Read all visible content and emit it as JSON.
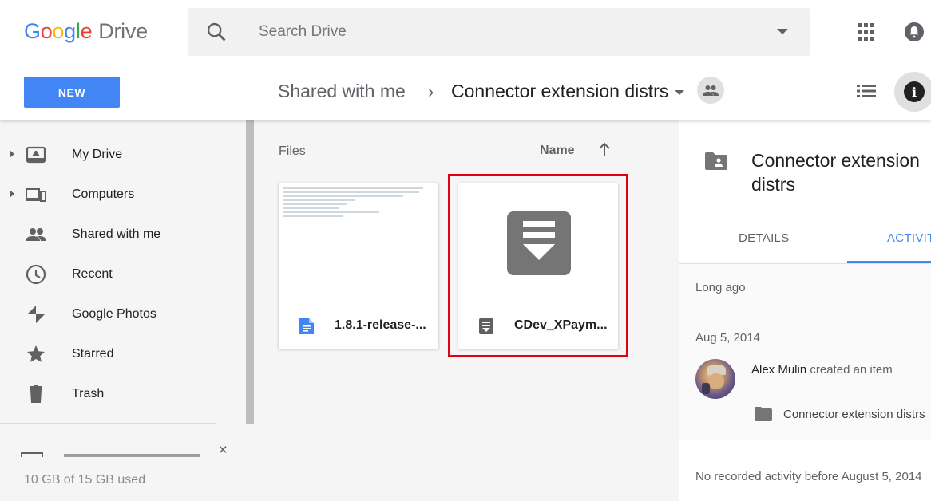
{
  "header": {
    "logo_google": "Google",
    "logo_drive": "Drive",
    "search_placeholder": "Search Drive",
    "new_button": "NEW",
    "breadcrumb_parent": "Shared with me",
    "breadcrumb_separator": "›",
    "breadcrumb_current": "Connector extension distrs"
  },
  "sidebar": {
    "items": [
      {
        "label": "My Drive",
        "icon": "drive-icon",
        "expandable": true
      },
      {
        "label": "Computers",
        "icon": "computers-icon",
        "expandable": true
      },
      {
        "label": "Shared with me",
        "icon": "people-icon",
        "expandable": false
      },
      {
        "label": "Recent",
        "icon": "clock-icon",
        "expandable": false
      },
      {
        "label": "Google Photos",
        "icon": "pinwheel-icon",
        "expandable": false
      },
      {
        "label": "Starred",
        "icon": "star-icon",
        "expandable": false
      },
      {
        "label": "Trash",
        "icon": "trash-icon",
        "expandable": false
      }
    ],
    "storage": "10 GB of 15 GB used"
  },
  "main": {
    "section_label": "Files",
    "sort_label": "Name",
    "files": [
      {
        "name": "1.8.1-release-...",
        "icon": "google-doc-icon"
      },
      {
        "name": "CDev_XPaym...",
        "icon": "download-file-icon"
      }
    ]
  },
  "details": {
    "title_line1": "Connector extension",
    "title_line2": "distrs",
    "tabs": [
      "DETAILS",
      "ACTIVITY"
    ],
    "active_tab": "ACTIVITY",
    "period": "Long ago",
    "date": "Aug 5, 2014",
    "user": "Alex Mulin",
    "action": "created an item",
    "item": "Connector extension distrs",
    "footer": "No recorded activity before August 5, 2014"
  },
  "colors": {
    "accent": "#4285f4",
    "highlight": "#e0000e"
  }
}
